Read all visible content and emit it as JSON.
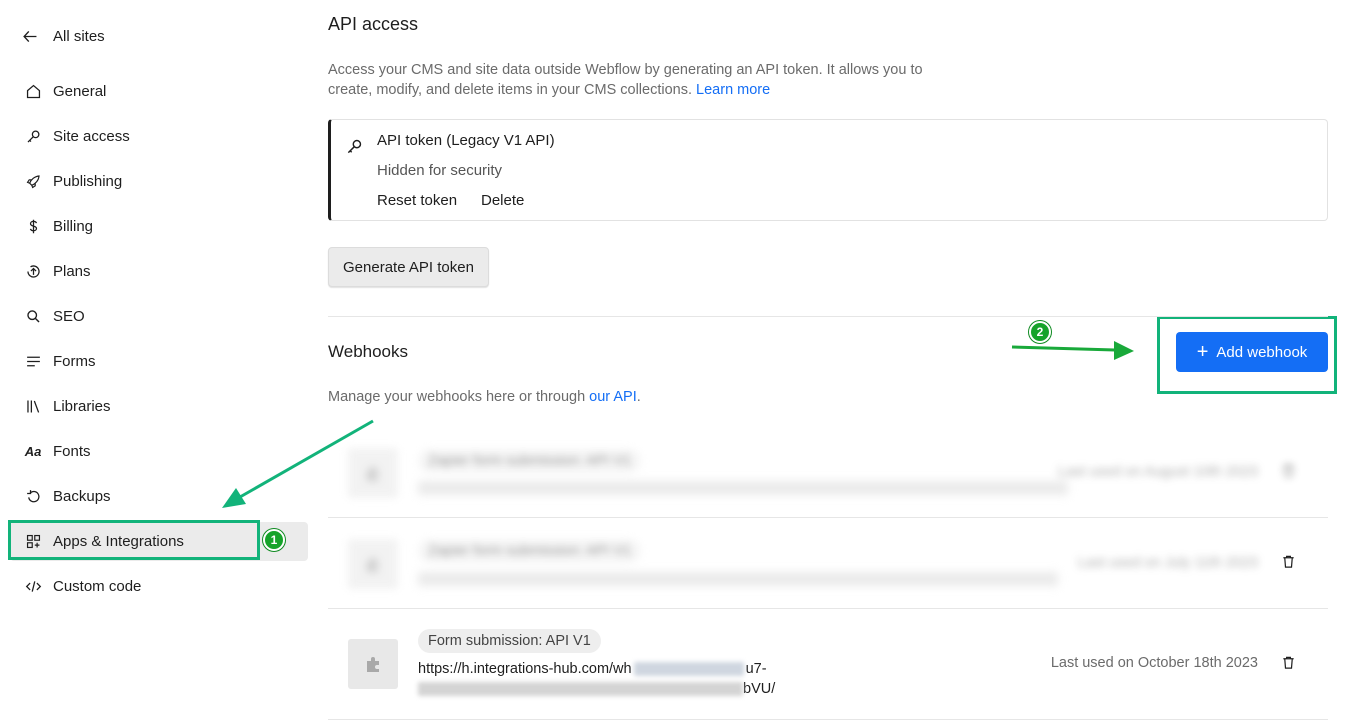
{
  "sidebar": {
    "back_label": "All sites",
    "items": [
      {
        "label": "General",
        "icon": "home-icon"
      },
      {
        "label": "Site access",
        "icon": "key-icon"
      },
      {
        "label": "Publishing",
        "icon": "rocket-icon"
      },
      {
        "label": "Billing",
        "icon": "dollar-icon"
      },
      {
        "label": "Plans",
        "icon": "upgrade-icon"
      },
      {
        "label": "SEO",
        "icon": "search-icon"
      },
      {
        "label": "Forms",
        "icon": "forms-icon"
      },
      {
        "label": "Libraries",
        "icon": "libraries-icon"
      },
      {
        "label": "Fonts",
        "icon": "fonts-icon"
      },
      {
        "label": "Backups",
        "icon": "backup-icon"
      },
      {
        "label": "Apps & Integrations",
        "icon": "apps-icon",
        "active": true
      },
      {
        "label": "Custom code",
        "icon": "code-icon"
      }
    ],
    "fonts_glyph": "Aa"
  },
  "api_access": {
    "title": "API access",
    "description_line1": "Access your CMS and site data outside Webflow by generating an API token. It allows you to",
    "description_line2": "create, modify, and delete items in your CMS collections.",
    "learn_more": "Learn more",
    "token_card": {
      "title": "API token (Legacy V1 API)",
      "status": "Hidden for security",
      "reset_label": "Reset token",
      "delete_label": "Delete"
    },
    "generate_label": "Generate API token"
  },
  "webhooks": {
    "title": "Webhooks",
    "add_label": "Add webhook",
    "description": "Manage your webhooks here or through",
    "api_link": "our API",
    "period": ".",
    "rows": [
      {
        "name": "Zapier form submission: API V1",
        "used": "Last used on August 10th 2023",
        "blurred": true
      },
      {
        "name": "Zapier form submission: API V1",
        "used": "Last used on July 11th 2023",
        "blurred": true
      },
      {
        "name": "Form submission: API V1",
        "url_start": "https://h.integrations-hub.com/wh",
        "url_mid": "u7-",
        "url_end": "bVU/",
        "used": "Last used on October 18th 2023",
        "blurred": false
      }
    ]
  },
  "annotations": {
    "badge1": "1",
    "badge2": "2"
  },
  "colors": {
    "accent": "#146ef5",
    "highlight": "#12b37a",
    "badge": "#16a32a"
  }
}
